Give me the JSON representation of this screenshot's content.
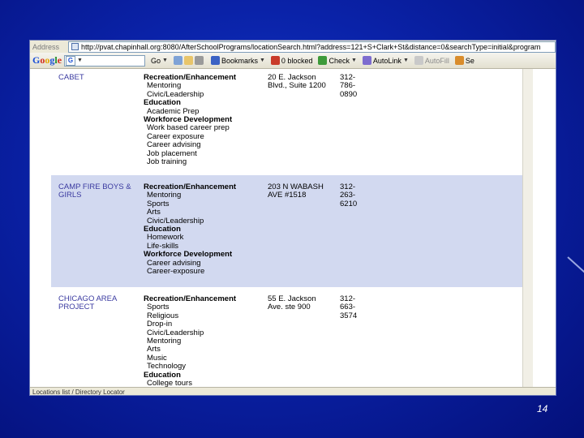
{
  "browser": {
    "address_label": "Address",
    "url": "http://pvat.chapinhall.org:8080/AfterSchoolPrograms/locationSearch.html?address=121+S+Clark+St&distance=0&searchType=initial&program",
    "status_text": "Locations list / Directory Locator"
  },
  "toolbar": {
    "search_engine": "Google",
    "go_label": "Go",
    "bookmarks_label": "Bookmarks",
    "blocked_label": "0 blocked",
    "check_label": "Check",
    "autolink_label": "AutoLink",
    "autofill_label": "AutoFill",
    "send_label": "Se"
  },
  "listings": [
    {
      "org": "CABET",
      "address": "20 E. Jackson Blvd., Suite 1200",
      "phone": "312-786-0890",
      "programs": [
        {
          "category": "Recreation/Enhancement",
          "items": [
            "Mentoring",
            "Civic/Leadership"
          ]
        },
        {
          "category": "Education",
          "items": [
            "Academic Prep"
          ]
        },
        {
          "category": "Workforce Development",
          "items": [
            "Work based career prep",
            "Career exposure",
            "Career advising",
            "Job placement",
            "Job training"
          ]
        }
      ]
    },
    {
      "org": "CAMP FIRE BOYS & GIRLS",
      "address": "203 N WABASH AVE #1518",
      "phone": "312-263-6210",
      "programs": [
        {
          "category": "Recreation/Enhancement",
          "items": [
            "Mentoring",
            "Sports",
            "Arts",
            "Civic/Leadership"
          ]
        },
        {
          "category": "Education",
          "items": [
            "Homework",
            "Life-skills"
          ]
        },
        {
          "category": "Workforce Development",
          "items": [
            "Career advising",
            "Career-exposure"
          ]
        }
      ]
    },
    {
      "org": "CHICAGO AREA PROJECT",
      "address": "55 E. Jackson Ave. ste 900",
      "phone": "312-663-3574",
      "programs": [
        {
          "category": "Recreation/Enhancement",
          "items": [
            "Sports",
            "Religious",
            "Drop-in",
            "Civic/Leadership",
            "Mentoring",
            "Arts",
            "Music",
            "Technology"
          ]
        },
        {
          "category": "Education",
          "items": [
            "College tours"
          ]
        }
      ]
    }
  ],
  "slide": {
    "page_number": "14"
  },
  "colors": {
    "background": "#0a22a8",
    "row_shade": "#d2d9f0",
    "org_text": "#3a3aa0"
  }
}
